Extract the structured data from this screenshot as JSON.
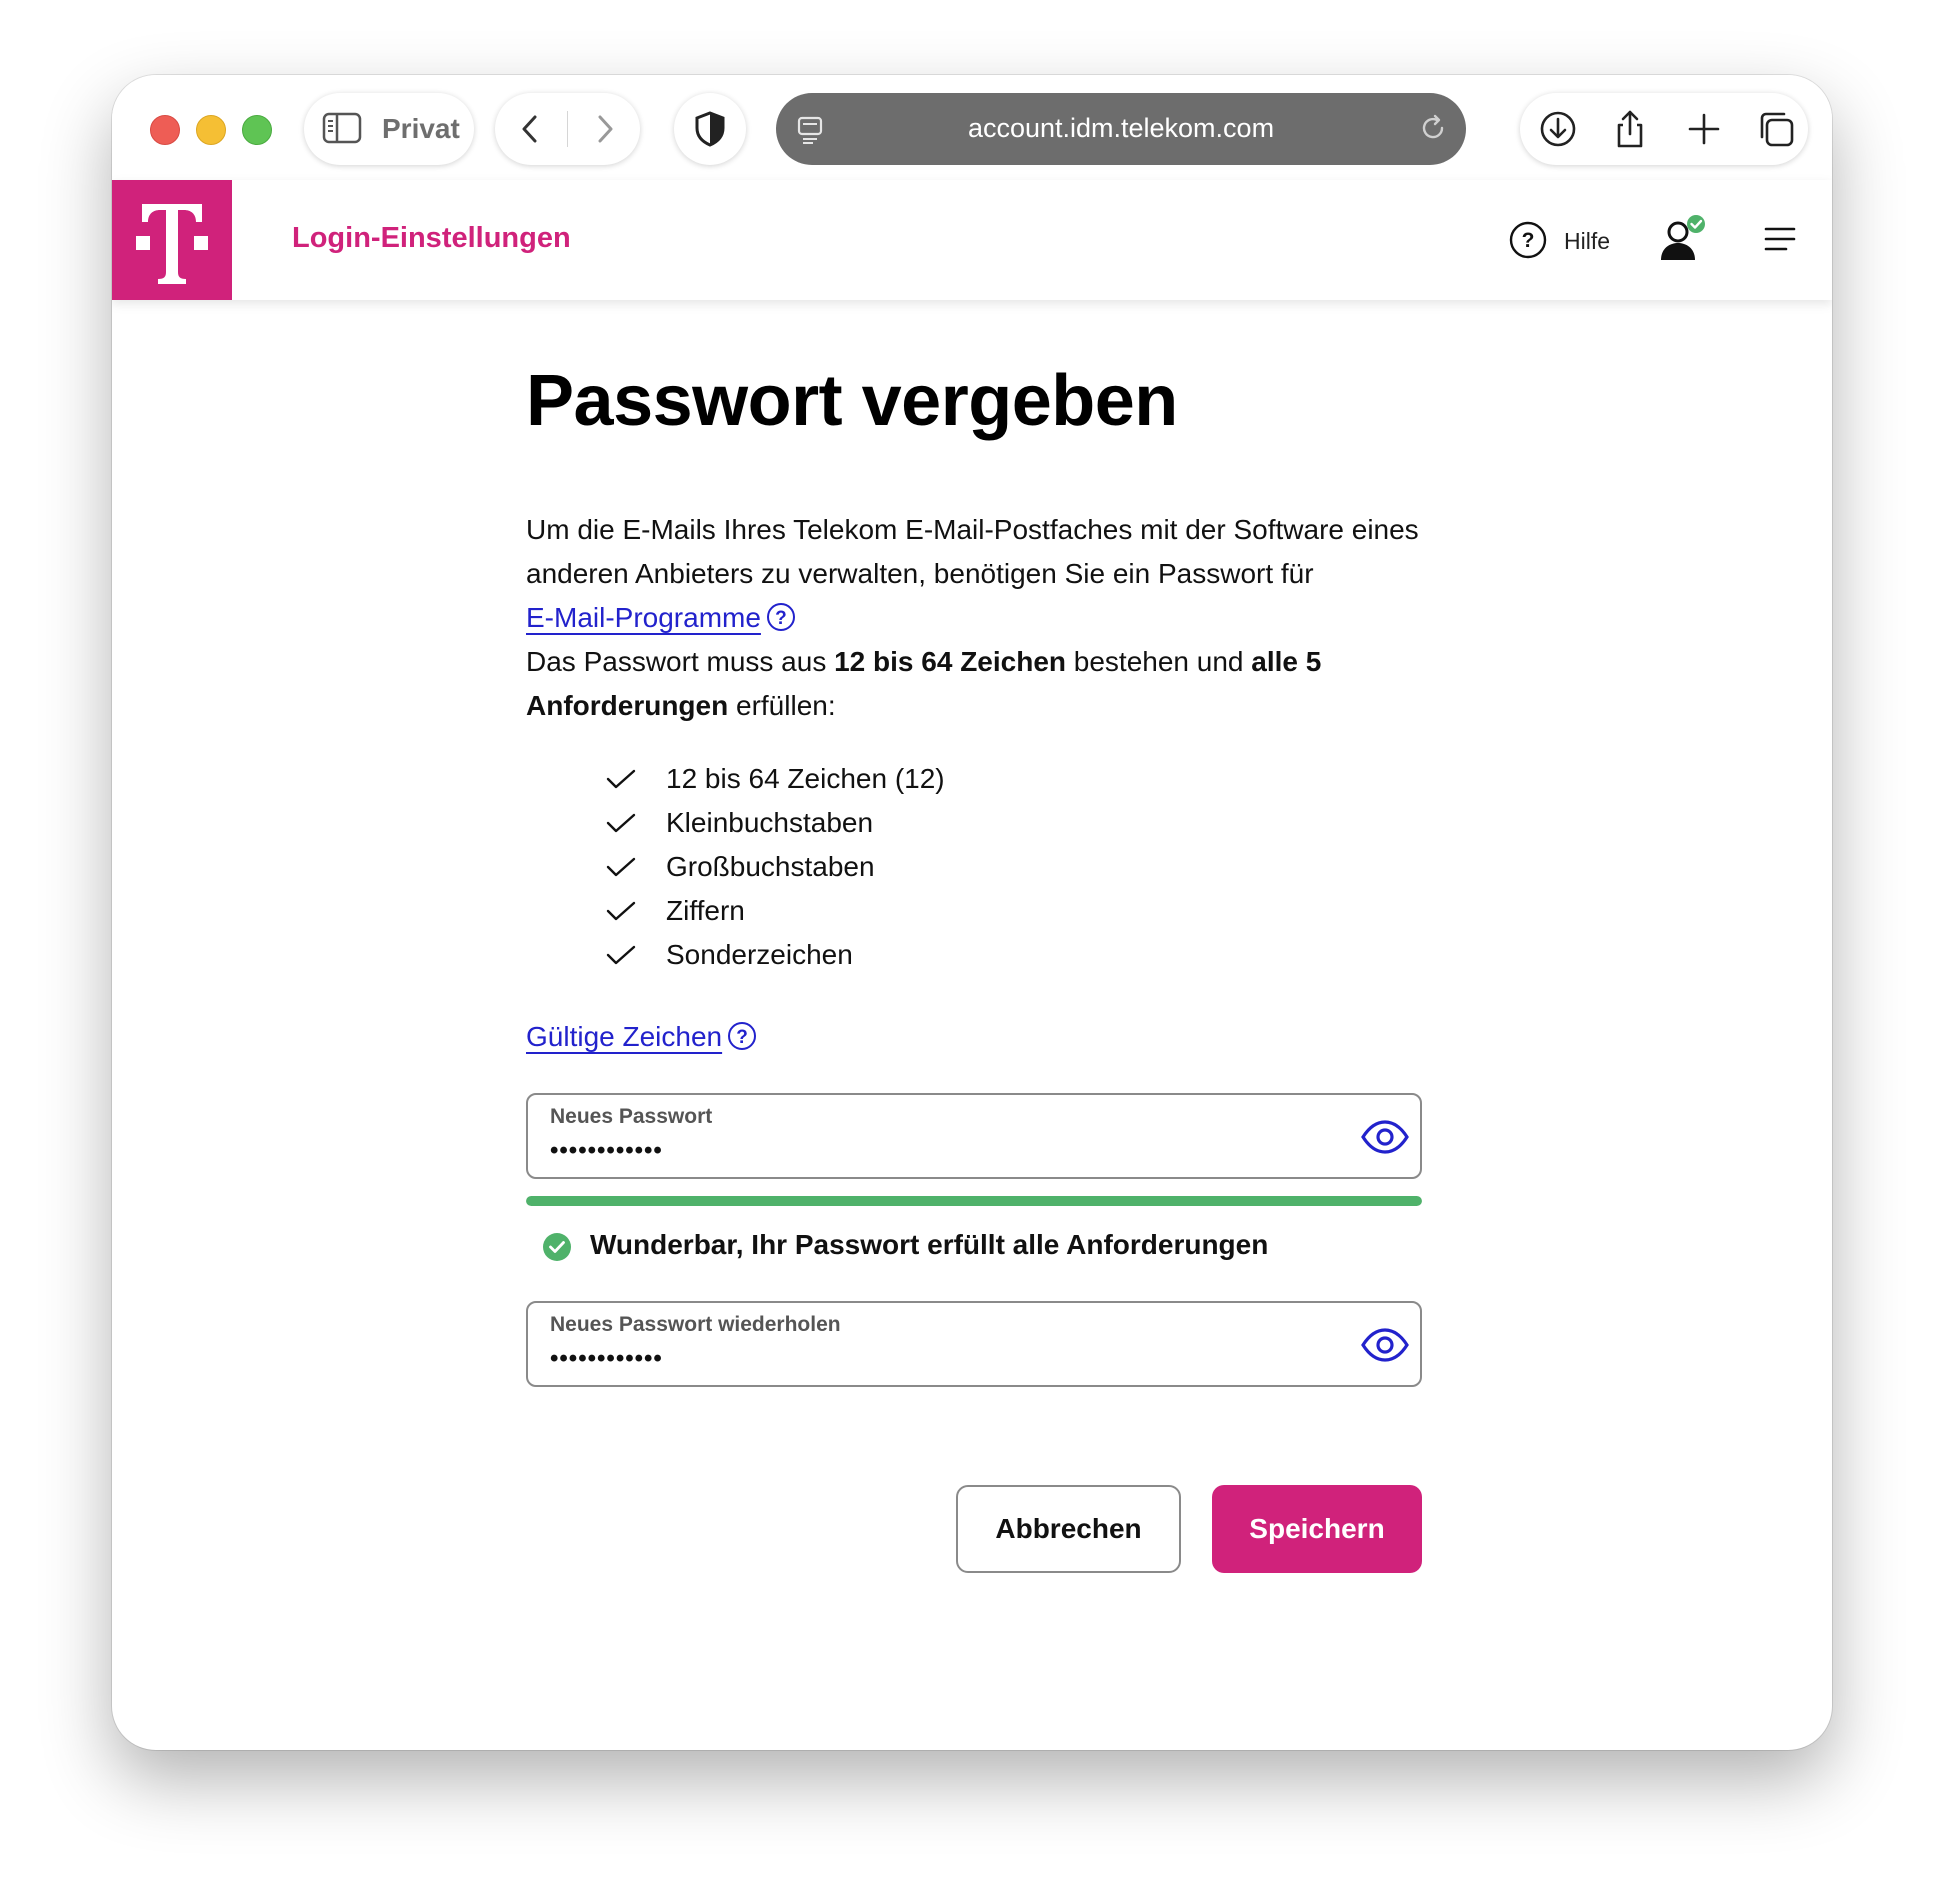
{
  "browser": {
    "profile_label": "Privat",
    "url": "account.idm.telekom.com"
  },
  "header": {
    "title": "Login-Einstellungen",
    "help_label": "Hilfe",
    "brand_color": "#d0227b"
  },
  "main": {
    "title": "Passwort vergeben",
    "intro_1": "Um die E-Mails Ihres Telekom E-Mail-Postfaches mit der Software eines anderen Anbieters zu verwalten, benötigen Sie ein Passwort für",
    "intro_link": "E-Mail-Programme",
    "intro_2a": "Das Passwort muss aus",
    "intro_2b": "12 bis 64 Zeichen",
    "intro_2c": "bestehen und",
    "intro_2d": "alle 5 Anforderungen",
    "intro_2e": "erfüllen:",
    "requirements": [
      {
        "label": "12 bis 64 Zeichen (12)",
        "met": true
      },
      {
        "label": "Kleinbuchstaben",
        "met": true
      },
      {
        "label": "Großbuchstaben",
        "met": true
      },
      {
        "label": "Ziffern",
        "met": true
      },
      {
        "label": "Sonderzeichen",
        "met": true
      }
    ],
    "valid_chars_link": "Gültige Zeichen",
    "new_password": {
      "label": "Neues Passwort",
      "value": "••••••••••••"
    },
    "strength": {
      "fraction": 1.0,
      "color": "#4fb26a"
    },
    "success_message": "Wunderbar, Ihr Passwort erfüllt alle Anforderungen",
    "repeat_password": {
      "label": "Neues Passwort wiederholen",
      "value": "••••••••••••"
    },
    "cancel_label": "Abbrechen",
    "save_label": "Speichern"
  },
  "icons": {
    "help": "question-circle",
    "user": "user-verified",
    "menu": "hamburger",
    "eye": "eye",
    "check": "checkmark"
  }
}
